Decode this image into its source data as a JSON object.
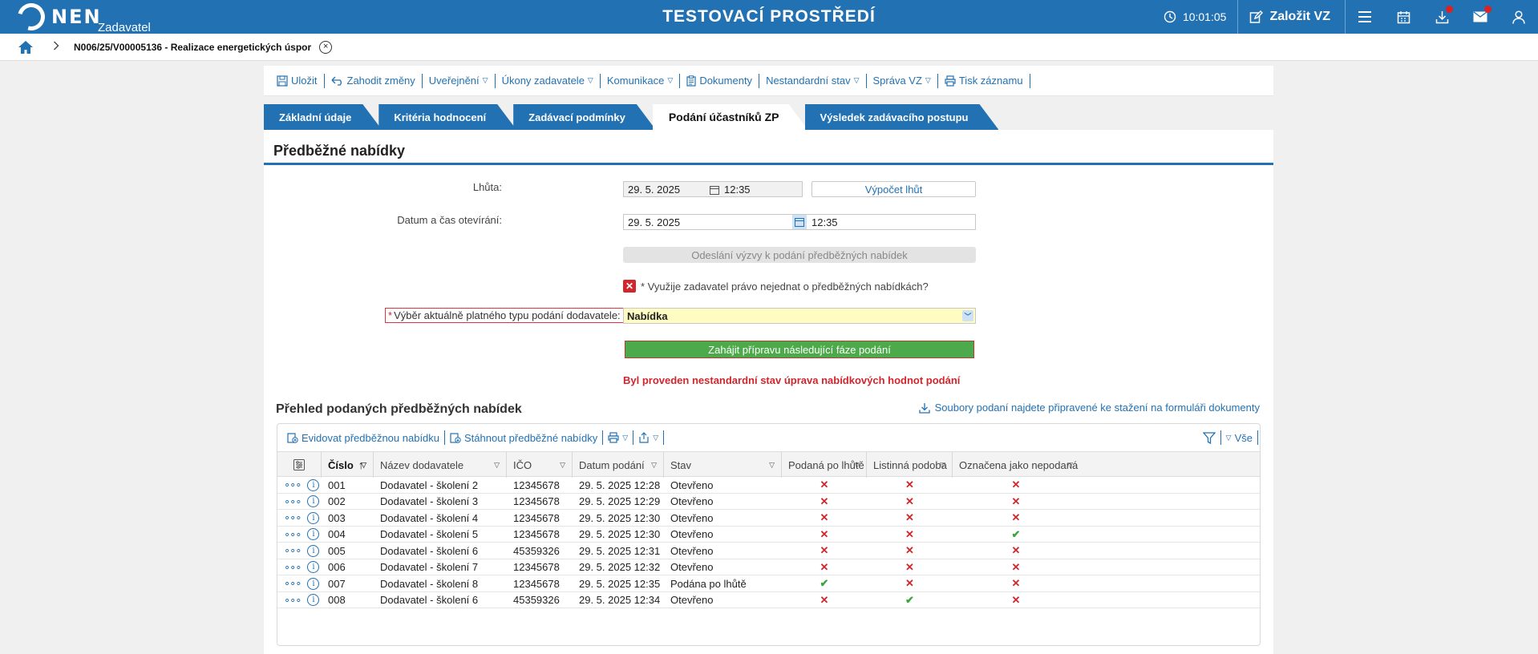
{
  "header": {
    "logo_text": "NEN",
    "logo_sub": "Zadavatel",
    "title": "TESTOVACÍ PROSTŘEDÍ",
    "clock": "10:01:05",
    "new_vz_label": "Založit VZ",
    "colors": {
      "brand": "#2271b3",
      "badge": "#e02020"
    },
    "icons": [
      "clock-icon",
      "edit-icon",
      "menu-icon",
      "calendar-icon",
      "download-icon",
      "mail-icon",
      "user-icon"
    ]
  },
  "breadcrumb": {
    "text": "N006/25/V00005136 - Realizace energetických úspor"
  },
  "toolbar": {
    "items": [
      {
        "label": "Uložit",
        "icon": "save-icon",
        "caret": false
      },
      {
        "label": "Zahodit změny",
        "icon": "undo-icon",
        "caret": false
      },
      {
        "label": "Uveřejnění",
        "icon": "",
        "caret": true
      },
      {
        "label": "Úkony zadavatele",
        "icon": "",
        "caret": true
      },
      {
        "label": "Komunikace",
        "icon": "",
        "caret": true
      },
      {
        "label": "Dokumenty",
        "icon": "clipboard-icon",
        "caret": false
      },
      {
        "label": "Nestandardní stav",
        "icon": "",
        "caret": true
      },
      {
        "label": "Správa VZ",
        "icon": "",
        "caret": true
      },
      {
        "label": "Tisk záznamu",
        "icon": "print-icon",
        "caret": false
      }
    ]
  },
  "tabs": [
    {
      "label": "Základní údaje",
      "active": false
    },
    {
      "label": "Kritéria hodnocení",
      "active": false
    },
    {
      "label": "Zadávací podmínky",
      "active": false
    },
    {
      "label": "Podání účastníků ZP",
      "active": true
    },
    {
      "label": "Výsledek zadávacího postupu",
      "active": false
    }
  ],
  "panel": {
    "title": "Předběžné nabídky",
    "deadline_label": "Lhůta:",
    "deadline_date": "29. 5. 2025",
    "deadline_time": "12:35",
    "calc_button": "Výpočet lhůt",
    "opening_label": "Datum a čas otevírání:",
    "opening_date": "29. 5. 2025",
    "opening_time": "12:35",
    "send_button": "Odeslání výzvy k podání předběžných nabídek",
    "check_label": "* Využije zadavatel právo nejednat o předběžných nabídkách?",
    "type_label": "Výběr aktuálně platného typu podání dodavatele:",
    "type_value": "Nabídka",
    "start_button": "Zahájit přípravu následující fáze podání",
    "error_text": "Byl proveden nestandardní stav úprava nabídkových hodnot podání"
  },
  "overview": {
    "title": "Přehled podaných předběžných nabídek",
    "download_link": "Soubory podaní najdete připravené ke stažení na formuláři dokumenty",
    "grid_toolbar": {
      "register": "Evidovat předběžnou nabídku",
      "download": "Stáhnout předběžné nabídky",
      "filter_all": "Vše"
    },
    "columns": [
      "Číslo",
      "Název dodavatele",
      "IČO",
      "Datum podání",
      "Stav",
      "Podaná po lhůtě",
      "Listinná podoba",
      "Označena jako nepodaná"
    ],
    "rows": [
      {
        "cislo": "001",
        "nazev": "Dodavatel - školení 2",
        "ico": "12345678",
        "datum": "29. 5. 2025 12:28",
        "stav": "Otevřeno",
        "po_lhute": false,
        "listinna": false,
        "nepodana": false
      },
      {
        "cislo": "002",
        "nazev": "Dodavatel - školení 3",
        "ico": "12345678",
        "datum": "29. 5. 2025 12:29",
        "stav": "Otevřeno",
        "po_lhute": false,
        "listinna": false,
        "nepodana": false
      },
      {
        "cislo": "003",
        "nazev": "Dodavatel - školení 4",
        "ico": "12345678",
        "datum": "29. 5. 2025 12:30",
        "stav": "Otevřeno",
        "po_lhute": false,
        "listinna": false,
        "nepodana": false
      },
      {
        "cislo": "004",
        "nazev": "Dodavatel - školení 5",
        "ico": "12345678",
        "datum": "29. 5. 2025 12:30",
        "stav": "Otevřeno",
        "po_lhute": false,
        "listinna": false,
        "nepodana": true
      },
      {
        "cislo": "005",
        "nazev": "Dodavatel - školení 6",
        "ico": "45359326",
        "datum": "29. 5. 2025 12:31",
        "stav": "Otevřeno",
        "po_lhute": false,
        "listinna": false,
        "nepodana": false
      },
      {
        "cislo": "006",
        "nazev": "Dodavatel - školení 7",
        "ico": "12345678",
        "datum": "29. 5. 2025 12:32",
        "stav": "Otevřeno",
        "po_lhute": false,
        "listinna": false,
        "nepodana": false
      },
      {
        "cislo": "007",
        "nazev": "Dodavatel - školení 8",
        "ico": "12345678",
        "datum": "29. 5. 2025 12:35",
        "stav": "Podána po lhůtě",
        "po_lhute": true,
        "listinna": false,
        "nepodana": false
      },
      {
        "cislo": "008",
        "nazev": "Dodavatel - školení 6",
        "ico": "45359326",
        "datum": "29. 5. 2025 12:34",
        "stav": "Otevřeno",
        "po_lhute": false,
        "listinna": true,
        "nepodana": false
      }
    ]
  }
}
